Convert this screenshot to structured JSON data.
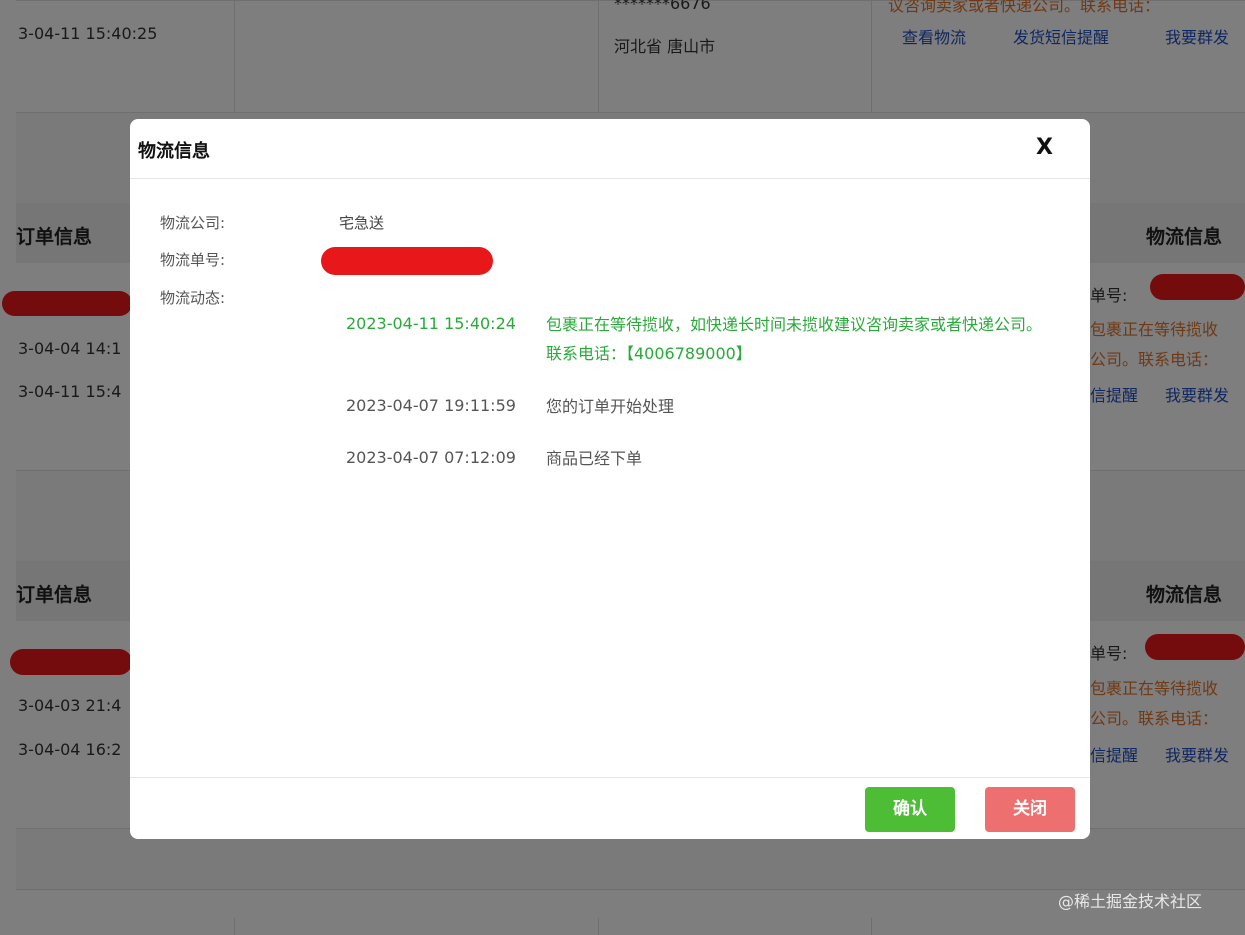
{
  "background": {
    "row1": {
      "time": "3-04-11 15:40:25",
      "masked_phone": "*******6676",
      "address": "河北省 唐山市",
      "notice": "议咨询卖家或者快递公司。联系电话：",
      "actions": [
        "查看物流",
        "发货短信提醒",
        "我要群发"
      ]
    },
    "order1": {
      "header_left": "订单信息",
      "header_right": "物流信息",
      "time_a": "3-04-04 14:1",
      "time_b": "3-04-11 15:4",
      "track_label": "单号:",
      "track_line1": "包裹正在等待揽收",
      "track_line2": "公司。联系电话：",
      "actions": [
        "信提醒",
        "我要群发"
      ]
    },
    "order2": {
      "header_left": "订单信息",
      "header_right": "物流信息",
      "time_a": "3-04-03 21:4",
      "time_b": "3-04-04 16:2",
      "track_label": "单号:",
      "track_line1": "包裹正在等待揽收",
      "track_line2": "公司。联系电话：",
      "actions": [
        "信提醒",
        "我要群发"
      ]
    }
  },
  "modal": {
    "title": "物流信息",
    "close_glyph": "X",
    "company_label": "物流公司:",
    "company_value": "宅急送",
    "tracking_label": "物流单号:",
    "dynamics_label": "物流动态:",
    "events": [
      {
        "time": "2023-04-11 15:40:24",
        "desc": "包裹正在等待揽收，如快递长时间未揽收建议咨询卖家或者快递公司。联系电话：【4006789000】",
        "latest": true
      },
      {
        "time": "2023-04-07 19:11:59",
        "desc": "您的订单开始处理",
        "latest": false
      },
      {
        "time": "2023-04-07 07:12:09",
        "desc": "商品已经下单",
        "latest": false
      }
    ],
    "confirm_label": "确认",
    "close_label": "关闭"
  },
  "colors": {
    "latest_event": "#2aaa3a",
    "confirm": "#4cbd34",
    "close": "#ee6f6f",
    "link": "#1f4fc0",
    "notice": "#e0732a",
    "redaction": "#e8171a"
  },
  "watermark": "@稀土掘金技术社区"
}
